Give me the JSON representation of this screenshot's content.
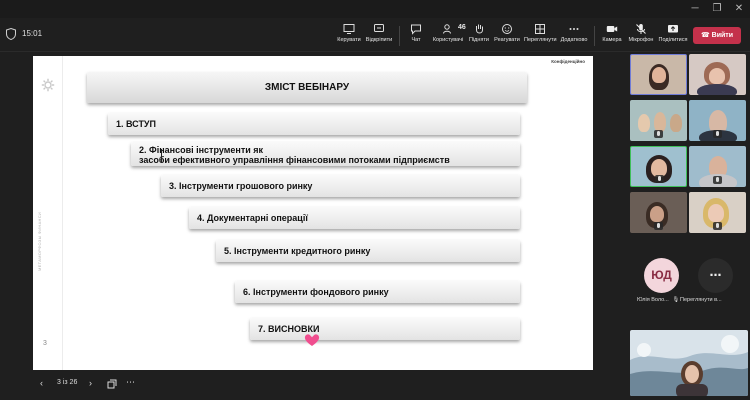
{
  "toolbar": {
    "timer": "15:01",
    "buttons": [
      {
        "label": "Керувати",
        "icon": "share-tray-icon"
      },
      {
        "label": "Відкріпити",
        "icon": "unpin-icon"
      },
      {
        "label": "Чат",
        "icon": "chat-icon"
      },
      {
        "label": "Користувачі",
        "icon": "people-icon",
        "count": "46"
      },
      {
        "label": "Підняти",
        "icon": "raise-hand-icon"
      },
      {
        "label": "Реагувати",
        "icon": "react-icon"
      },
      {
        "label": "Переглянути",
        "icon": "view-icon"
      },
      {
        "label": "Додатково",
        "icon": "more-icon"
      },
      {
        "label": "Камера",
        "icon": "camera-icon"
      },
      {
        "label": "Мікрофон",
        "icon": "mic-off-icon"
      },
      {
        "label": "Поділитися",
        "icon": "share-icon"
      }
    ],
    "leave_label": "Вийти",
    "leave_color": "#c4314b"
  },
  "slide": {
    "confidential": "Конфіденційно",
    "title": "ЗМІСТ ВЕБІНАРУ",
    "side_text": "MEТАМОРФОЗЫ ФИНАНСИ",
    "page_number": "3",
    "items": [
      {
        "text": "1. ВСТУП"
      },
      {
        "line1": "2. Фінансові інструменти як",
        "line2": "засоби ефективного управління фінансовими потоками підприємств"
      },
      {
        "text": "3. Інструменти грошового ринку"
      },
      {
        "text": "4. Документарні операції"
      },
      {
        "text": "5. Інструменти кредитного ринку"
      },
      {
        "text": "6. Інструменти фондового ринку"
      },
      {
        "text": "7. ВИСНОВКИ"
      }
    ]
  },
  "pager": {
    "label": "3 із 26"
  },
  "participants": {
    "avatar_initials": "ЮД",
    "avatar_name": "Юлія Воло...",
    "more_label": "Переглянути в...",
    "avatar_color": "#f3d6dc",
    "avatar_text_color": "#8a2d44"
  }
}
